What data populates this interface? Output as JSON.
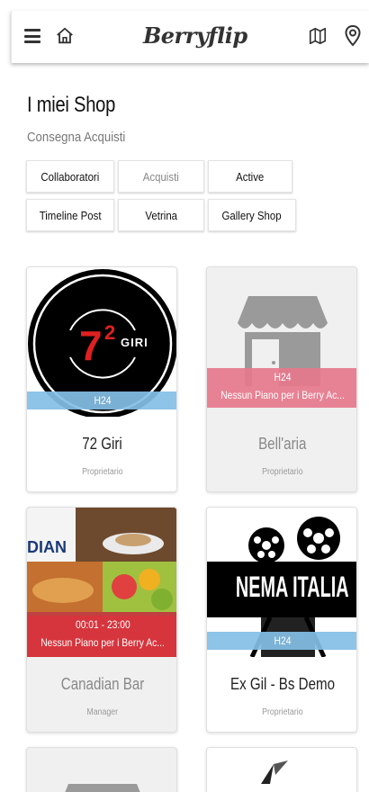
{
  "header": {
    "brand": "Berryflip",
    "icons": [
      "menu-icon",
      "home-icon",
      "map-icon",
      "location-pin-icon"
    ]
  },
  "page": {
    "title": "I miei Shop",
    "subtitle": "Consegna Acquisti"
  },
  "tabs": [
    {
      "label": "Collaboratori"
    },
    {
      "label": "Acquisti"
    },
    {
      "label": "Active"
    },
    {
      "label": "Timeline Post"
    },
    {
      "label": "Vetrina"
    },
    {
      "label": "Gallery Shop"
    }
  ],
  "shops": [
    {
      "name": "72 Giri",
      "role": "Proprietario",
      "hours": "H24",
      "plan": "",
      "logo_text": "GIRI",
      "logo_number": "7",
      "logo_sup": "2"
    },
    {
      "name": "Bell'aria",
      "role": "Proprietario",
      "hours": "H24",
      "plan": "Nessun Piano per i Berry Ac..."
    },
    {
      "name": "Canadian Bar",
      "role": "Manager",
      "hours": "00:01 - 23:00",
      "plan": "Nessun Piano per i Berry Ac...",
      "logo_text": "DIAN"
    },
    {
      "name": "Ex Gil - Bs Demo",
      "role": "Proprietario",
      "hours": "H24",
      "plan": "",
      "logo_text": "NEMA ITALIA"
    }
  ],
  "colors": {
    "badge_blue": "#84bfe6",
    "badge_pink": "#e6788c",
    "placeholder_gray": "#9a9a9a"
  }
}
